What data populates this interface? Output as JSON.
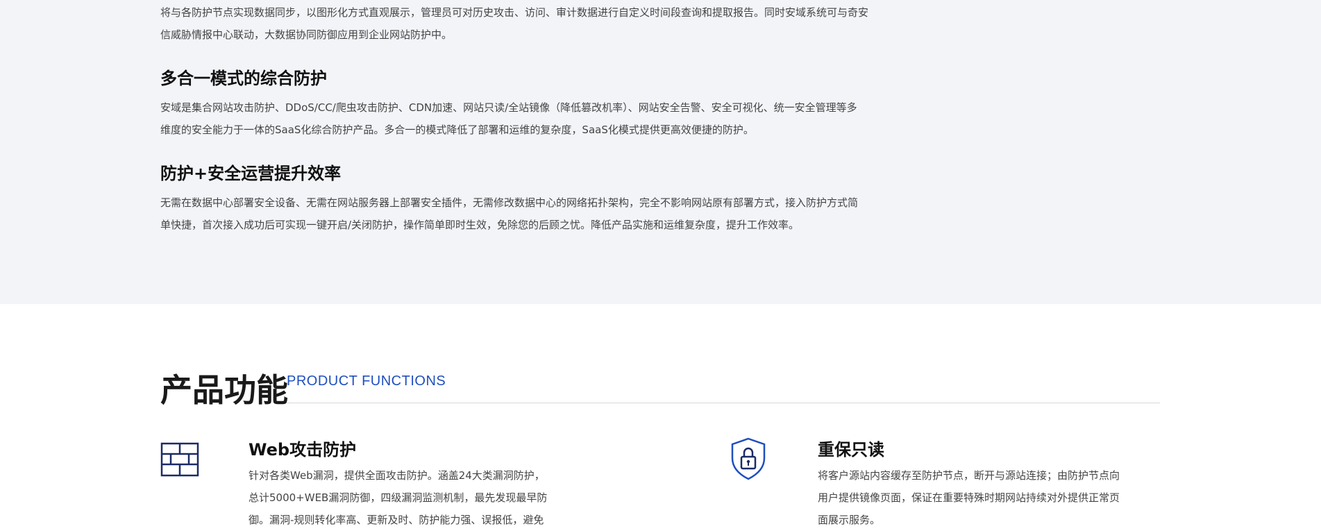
{
  "intro": {
    "line1": "将与各防护节点实现数据同步，以图形化方式直观展示，管理员可对历史攻击、访问、审计数据进行自定义时间段查询和提取报告。同时安域系统可与奇安",
    "line2": "信威胁情报中心联动，大数据协同防御应用到企业网站防护中。"
  },
  "features": [
    {
      "title": "多合一模式的综合防护",
      "desc_line1": "安域是集合网站攻击防护、DDoS/CC/爬虫攻击防护、CDN加速、网站只读/全站镜像（降低篡改机率）、网站安全告警、安全可视化、统一安全管理等多",
      "desc_line2": "维度的安全能力于一体的SaaS化综合防护产品。多合一的模式降低了部署和运维的复杂度，SaaS化模式提供更高效便捷的防护。"
    },
    {
      "title": "防护+安全运营提升效率",
      "desc_line1": "无需在数据中心部署安全设备、无需在网站服务器上部署安全插件，无需修改数据中心的网络拓扑架构，完全不影响网站原有部署方式，接入防护方式简",
      "desc_line2": "单快捷，首次接入成功后可实现一键开启/关闭防护，操作简单即时生效，免除您的后顾之忧。降低产品实施和运维复杂度，提升工作效率。"
    }
  ],
  "product_functions": {
    "title": "产品功能",
    "subtitle": "PRODUCT FUNCTIONS",
    "items": [
      {
        "title": "Web攻击防护",
        "icon": "firewall-icon",
        "desc_line1": "针对各类Web漏洞，提供全面攻击防护。涵盖24大类漏洞防护，",
        "desc_line2": "总计5000+WEB漏洞防御，四级漏洞监测机制，最先发现最早防",
        "desc_line3": "御。漏洞-规则转化率高、更新及时、防护能力强、误报低，避免"
      },
      {
        "title": "重保只读",
        "icon": "shield-lock-icon",
        "desc_line1": "将客户源站内容缓存至防护节点，断开与源站连接；由防护节点向",
        "desc_line2": "用户提供镜像页面，保证在重要特殊时期网站持续对外提供正常页",
        "desc_line3": "面展示服务。"
      }
    ]
  },
  "colors": {
    "accent": "#1f4fbf",
    "top_bg": "#f2f4f8"
  }
}
